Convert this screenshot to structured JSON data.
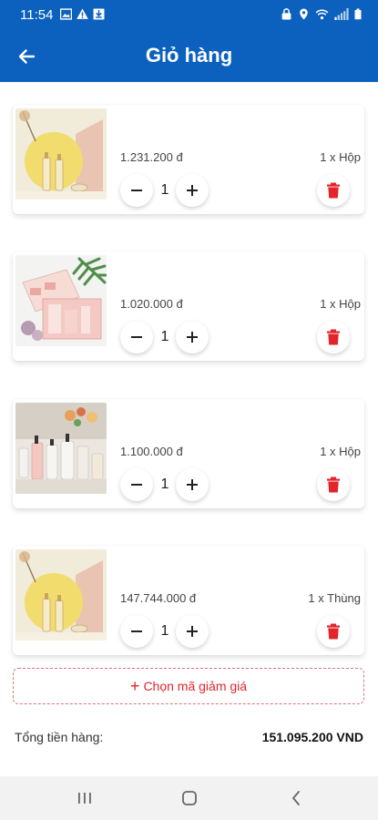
{
  "status_bar": {
    "time": "11:54",
    "left_icons": [
      "image-icon",
      "warning-icon",
      "download-icon"
    ],
    "right_icons": [
      "lock-icon",
      "location-icon",
      "wifi-icon",
      "signal-icon",
      "battery-icon"
    ]
  },
  "header": {
    "title": "Giỏ hàng",
    "back_icon": "arrow-left-icon",
    "background": "#0b61bd"
  },
  "cart": {
    "items": [
      {
        "price": "1.231.200 đ",
        "unit": "1 x Hộp",
        "quantity": "1",
        "image": "cosmetic-bottles-yellow"
      },
      {
        "price": "1.020.000 đ",
        "unit": "1 x Hộp",
        "quantity": "1",
        "image": "pink-gift-box"
      },
      {
        "price": "1.100.000 đ",
        "unit": "1 x Hộp",
        "quantity": "1",
        "image": "skincare-bottles-row"
      },
      {
        "price": "147.744.000 đ",
        "unit": "1 x Thùng",
        "quantity": "1",
        "image": "cosmetic-bottles-yellow"
      }
    ]
  },
  "coupon": {
    "plus": "+",
    "label": "Chọn mã giảm giá",
    "color": "#e3242b"
  },
  "summary": {
    "label": "Tổng tiền hàng:",
    "value": "151.095.200 VND"
  },
  "nav_bar": {
    "icons": [
      "recent-apps-icon",
      "home-icon",
      "back-icon"
    ]
  },
  "colors": {
    "primary": "#0b61bd",
    "delete": "#e3242b"
  }
}
